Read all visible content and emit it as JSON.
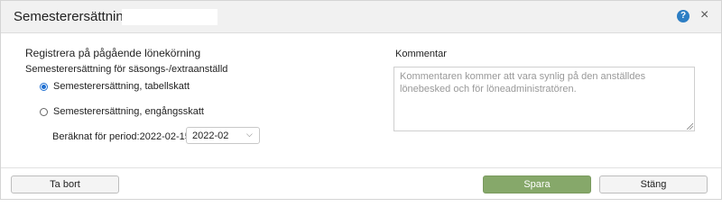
{
  "dialog": {
    "title": "Semesterersättning -",
    "help_icon_glyph": "?",
    "close_icon_glyph": "×"
  },
  "form": {
    "heading": "Registrera på pågående lönekörning",
    "subheading": "Semesterersättning för säsongs-/extraanställd",
    "options": [
      {
        "label": "Semesterersättning, tabellskatt",
        "checked": true
      },
      {
        "label": "Semesterersättning, engångsskatt",
        "checked": false
      }
    ],
    "period_label": "Beräknat för period:2022-02-15-",
    "period_value": "2022-02"
  },
  "comment": {
    "label": "Kommentar",
    "placeholder": "Kommentaren kommer att vara synlig på den anställdes lönebesked och för löneadministratören."
  },
  "footer": {
    "delete_label": "Ta bort",
    "save_label": "Spara",
    "close_label": "Stäng"
  },
  "colors": {
    "primary_button": "#86a86a",
    "help_icon": "#2d7ec4",
    "radio_selected": "#1f6fd1"
  }
}
